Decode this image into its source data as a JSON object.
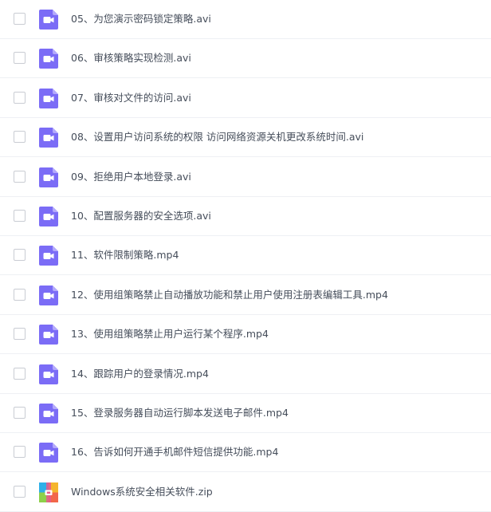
{
  "files": [
    {
      "name": "05、为您演示密码锁定策略.avi",
      "type": "video",
      "icon": "video-file-icon"
    },
    {
      "name": "06、审核策略实现检测.avi",
      "type": "video",
      "icon": "video-file-icon"
    },
    {
      "name": "07、审核对文件的访问.avi",
      "type": "video",
      "icon": "video-file-icon"
    },
    {
      "name": "08、设置用户访问系统的权限 访问网络资源关机更改系统时间.avi",
      "type": "video",
      "icon": "video-file-icon"
    },
    {
      "name": "09、拒绝用户本地登录.avi",
      "type": "video",
      "icon": "video-file-icon"
    },
    {
      "name": "10、配置服务器的安全选项.avi",
      "type": "video",
      "icon": "video-file-icon"
    },
    {
      "name": "11、软件限制策略.mp4",
      "type": "video",
      "icon": "video-file-icon"
    },
    {
      "name": "12、使用组策略禁止自动播放功能和禁止用户使用注册表编辑工具.mp4",
      "type": "video",
      "icon": "video-file-icon"
    },
    {
      "name": "13、使用组策略禁止用户运行某个程序.mp4",
      "type": "video",
      "icon": "video-file-icon"
    },
    {
      "name": "14、跟踪用户的登录情况.mp4",
      "type": "video",
      "icon": "video-file-icon"
    },
    {
      "name": "15、登录服务器自动运行脚本发送电子邮件.mp4",
      "type": "video",
      "icon": "video-file-icon"
    },
    {
      "name": "16、告诉如何开通手机邮件短信提供功能.mp4",
      "type": "video",
      "icon": "video-file-icon"
    },
    {
      "name": "Windows系统安全相关软件.zip",
      "type": "zip",
      "icon": "zip-file-icon"
    }
  ],
  "colors": {
    "video_icon": "#7b6cf6",
    "video_icon_fold": "#b3a9fb",
    "text": "#454d5a",
    "row_border": "#eef0f4",
    "checkbox_border": "#c9ccd3"
  }
}
